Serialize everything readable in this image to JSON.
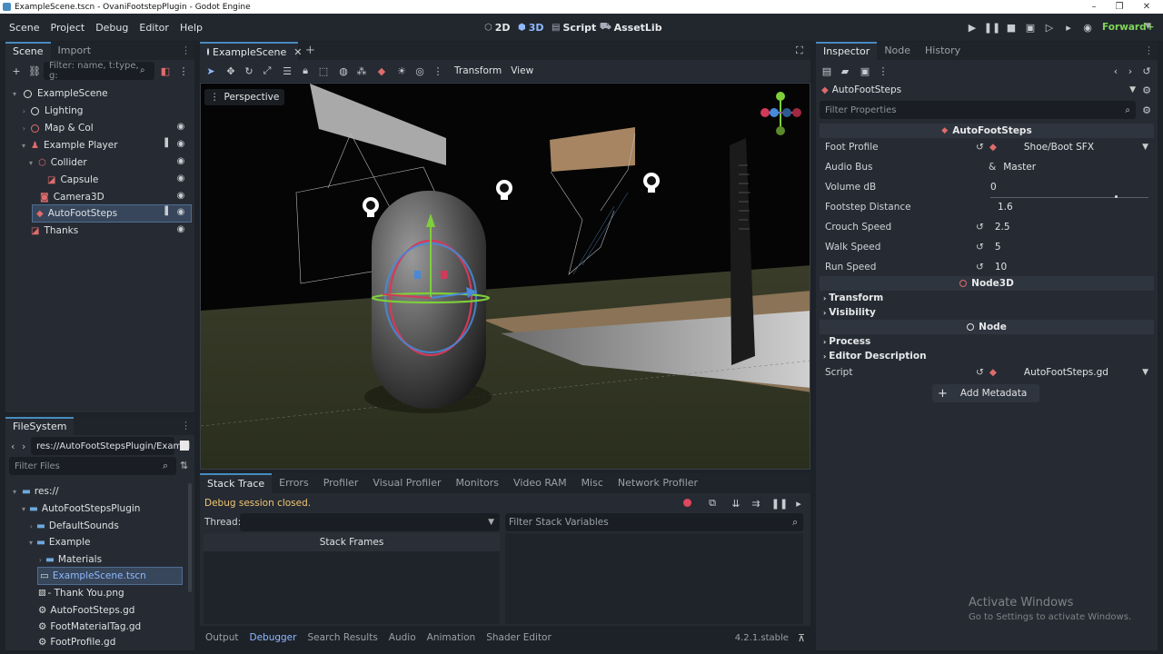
{
  "window": {
    "title": "ExampleScene.tscn - OvaniFootstepPlugin - Godot Engine"
  },
  "menu": [
    "Scene",
    "Project",
    "Debug",
    "Editor",
    "Help"
  ],
  "workspaces": {
    "w2d": "2D",
    "w3d": "3D",
    "script": "Script",
    "assetlib": "AssetLib"
  },
  "renderer": "Forward+",
  "scene_dock": {
    "tabs": [
      "Scene",
      "Import"
    ],
    "filter_placeholder": "Filter: name, t:type, g:",
    "tree": [
      {
        "label": "ExampleScene"
      },
      {
        "label": "Lighting"
      },
      {
        "label": "Map & Col"
      },
      {
        "label": "Example Player"
      },
      {
        "label": "Collider"
      },
      {
        "label": "Capsule"
      },
      {
        "label": "Camera3D"
      },
      {
        "label": "AutoFootSteps"
      },
      {
        "label": "Thanks"
      }
    ]
  },
  "filesystem": {
    "tab": "FileSystem",
    "path": "res://AutoFootStepsPlugin/Exampl",
    "filter_placeholder": "Filter Files",
    "items": [
      {
        "label": "res://"
      },
      {
        "label": "AutoFootStepsPlugin"
      },
      {
        "label": "DefaultSounds"
      },
      {
        "label": "Example"
      },
      {
        "label": "Materials"
      },
      {
        "label": "ExampleScene.tscn"
      },
      {
        "label": "- Thank You.png"
      },
      {
        "label": "AutoFootSteps.gd"
      },
      {
        "label": "FootMaterialTag.gd"
      },
      {
        "label": "FootProfile.gd"
      }
    ]
  },
  "editor_tab": {
    "label": "ExampleScene"
  },
  "viewport_toolbar": {
    "transform": "Transform",
    "view": "View"
  },
  "viewport": {
    "perspective": "Perspective"
  },
  "bottom": {
    "tabs": [
      "Stack Trace",
      "Errors",
      "Profiler",
      "Visual Profiler",
      "Monitors",
      "Video RAM",
      "Misc",
      "Network Profiler"
    ],
    "status": "Debug session closed.",
    "thread_label": "Thread:",
    "stack_frames": "Stack Frames",
    "filter_vars_placeholder": "Filter Stack Variables",
    "panel_tabs": [
      "Output",
      "Debugger",
      "Search Results",
      "Audio",
      "Animation",
      "Shader Editor"
    ],
    "version": "4.2.1.stable"
  },
  "inspector": {
    "tabs": [
      "Inspector",
      "Node",
      "History"
    ],
    "node_name": "AutoFootSteps",
    "filter_placeholder": "Filter Properties",
    "section_title": "AutoFootSteps",
    "props": [
      {
        "label": "Foot Profile",
        "value": "Shoe/Boot SFX"
      },
      {
        "label": "Audio Bus",
        "value": "Master"
      },
      {
        "label": "Volume dB",
        "value": "0"
      },
      {
        "label": "Footstep Distance",
        "value": "1.6"
      },
      {
        "label": "Crouch Speed",
        "value": "2.5"
      },
      {
        "label": "Walk Speed",
        "value": "5"
      },
      {
        "label": "Run Speed",
        "value": "10"
      }
    ],
    "node3d_section": "Node3D",
    "groups": [
      "Transform",
      "Visibility",
      "Process",
      "Editor Description"
    ],
    "node_section": "Node",
    "script_label": "Script",
    "script_value": "AutoFootSteps.gd",
    "add_metadata": "Add Metadata"
  },
  "watermark": {
    "line1": "Activate Windows",
    "line2": "Go to Settings to activate Windows."
  }
}
